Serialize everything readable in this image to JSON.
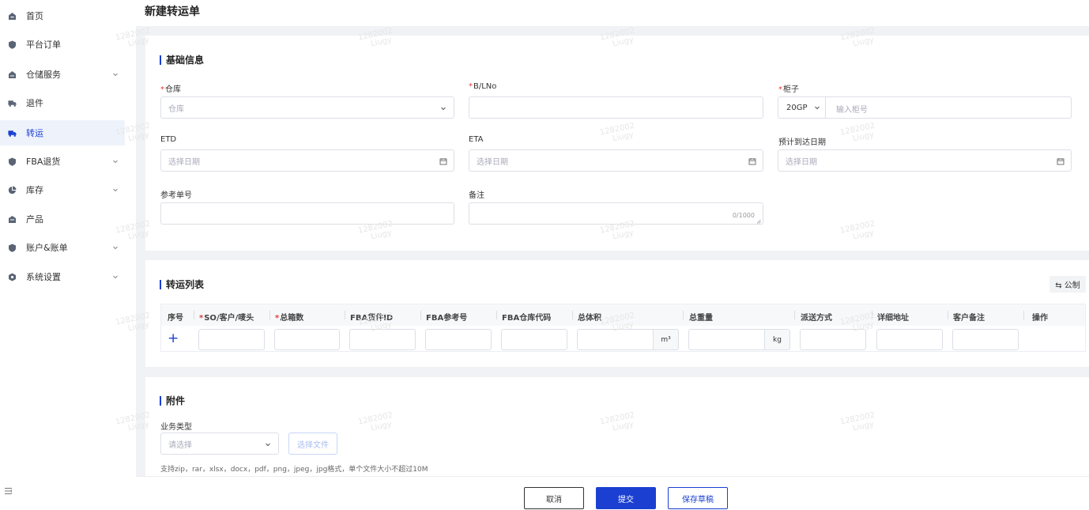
{
  "sidebar": {
    "items": [
      {
        "label": "首页",
        "icon": "home-icon",
        "chevron": false,
        "active": false
      },
      {
        "label": "平台订单",
        "icon": "shield-icon",
        "chevron": false,
        "active": false
      },
      {
        "label": "仓储服务",
        "icon": "warehouse-icon",
        "chevron": true,
        "active": false
      },
      {
        "label": "退件",
        "icon": "return-truck-icon",
        "chevron": false,
        "active": false
      },
      {
        "label": "转运",
        "icon": "truck-icon",
        "chevron": false,
        "active": true
      },
      {
        "label": "FBA退货",
        "icon": "shield-icon",
        "chevron": true,
        "active": false
      },
      {
        "label": "库存",
        "icon": "pie-chart-icon",
        "chevron": true,
        "active": false
      },
      {
        "label": "产品",
        "icon": "product-icon",
        "chevron": false,
        "active": false
      },
      {
        "label": "账户&账单",
        "icon": "shield-icon",
        "chevron": true,
        "active": false
      },
      {
        "label": "系统设置",
        "icon": "settings-icon",
        "chevron": true,
        "active": false
      }
    ]
  },
  "page": {
    "title": "新建转运单"
  },
  "basic": {
    "title": "基础信息",
    "warehouse": {
      "label": "仓库",
      "placeholder": "仓库"
    },
    "bl_no": {
      "label": "B/LNo",
      "value": ""
    },
    "container": {
      "label": "柜子",
      "type_value": "20GP",
      "placeholder": "输入柜号"
    },
    "etd": {
      "label": "ETD",
      "placeholder": "选择日期"
    },
    "eta": {
      "label": "ETA",
      "placeholder": "选择日期"
    },
    "arrival": {
      "label": "预计到达日期",
      "placeholder": "选择日期"
    },
    "ref_no": {
      "label": "参考单号",
      "value": ""
    },
    "remark": {
      "label": "备注",
      "counter": "0/1000"
    }
  },
  "transfer": {
    "title": "转运列表",
    "unit_toggle": "⇆ 公制",
    "columns": [
      "序号",
      "SO/客户/唛头",
      "总箱数",
      "FBA货件ID",
      "FBA参考号",
      "FBA仓库代码",
      "总体积",
      "总重量",
      "派送方式",
      "详细地址",
      "客户备注",
      "操作"
    ],
    "add_symbol": "+",
    "volume_unit": "m³",
    "weight_unit": "kg"
  },
  "attachment": {
    "title": "附件",
    "biz_type": {
      "label": "业务类型",
      "placeholder": "请选择"
    },
    "choose_file": "选择文件",
    "hint": "支持zip，rar，xlsx，docx，pdf，png，jpeg，jpg格式，单个文件大小不超过10M"
  },
  "footer": {
    "cancel": "取消",
    "submit": "提交",
    "save_draft": "保存草稿"
  },
  "watermark": {
    "line1": "1282002",
    "line2": "Liugy"
  },
  "colors": {
    "accent": "#1a3fd1",
    "required": "#e4393c"
  }
}
